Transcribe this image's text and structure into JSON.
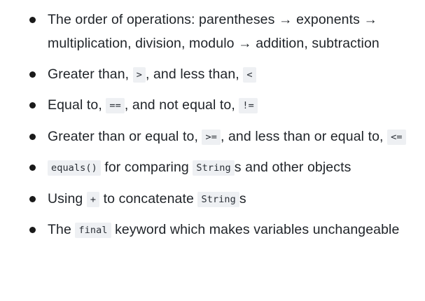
{
  "items": [
    {
      "text1": "The order of operations: parentheses → exponents → multiplication, division, modulo → addition, subtraction"
    },
    {
      "text1": "Greater than, ",
      "code1": ">",
      "text2": ", and less than, ",
      "code2": "<"
    },
    {
      "text1": "Equal to, ",
      "code1": "==",
      "text2": ", and not equal to, ",
      "code2": "!="
    },
    {
      "text1": "Greater than or equal to, ",
      "code1": ">=",
      "text2": ", and less than or equal to, ",
      "code2": "<="
    },
    {
      "code1": "equals()",
      "text1": " for comparing ",
      "code2": "String",
      "text2": "s and other objects"
    },
    {
      "text1": "Using ",
      "code1": "+",
      "text2": " to concatenate ",
      "code2": "String",
      "text3": "s"
    },
    {
      "text1": "The ",
      "code1": "final",
      "text2": " keyword which makes variables unchangeable"
    }
  ]
}
